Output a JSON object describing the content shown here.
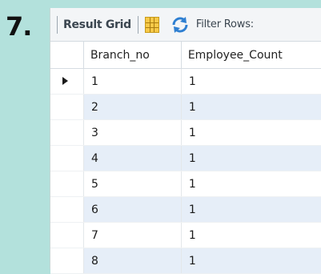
{
  "step": {
    "number": "7."
  },
  "toolbar": {
    "result_grid_label": "Result Grid",
    "filter_rows_label": "Filter Rows:",
    "icons": [
      "grid-icon",
      "refresh-icon"
    ]
  },
  "grid": {
    "columns": [
      "Branch_no",
      "Employee_Count"
    ],
    "rows": [
      [
        "1",
        "1"
      ],
      [
        "2",
        "1"
      ],
      [
        "3",
        "1"
      ],
      [
        "4",
        "1"
      ],
      [
        "5",
        "1"
      ],
      [
        "6",
        "1"
      ],
      [
        "7",
        "1"
      ],
      [
        "8",
        "1"
      ]
    ],
    "current_row": 0
  },
  "colors": {
    "background": "#b3e1dc",
    "alt_row": "#e6eef8",
    "grid_icon": "#f7c948",
    "refresh_icon": "#2e7fd1"
  }
}
